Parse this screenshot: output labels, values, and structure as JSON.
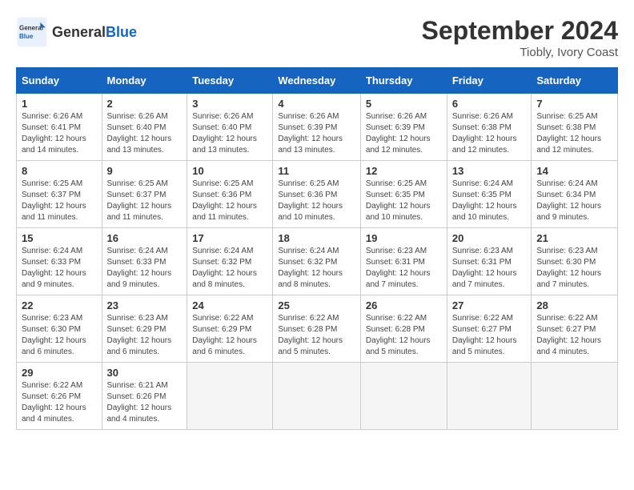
{
  "header": {
    "logo_general": "General",
    "logo_blue": "Blue",
    "month_title": "September 2024",
    "location": "Tiobly, Ivory Coast"
  },
  "days_of_week": [
    "Sunday",
    "Monday",
    "Tuesday",
    "Wednesday",
    "Thursday",
    "Friday",
    "Saturday"
  ],
  "weeks": [
    [
      {
        "day": "1",
        "info": "Sunrise: 6:26 AM\nSunset: 6:41 PM\nDaylight: 12 hours\nand 14 minutes."
      },
      {
        "day": "2",
        "info": "Sunrise: 6:26 AM\nSunset: 6:40 PM\nDaylight: 12 hours\nand 13 minutes."
      },
      {
        "day": "3",
        "info": "Sunrise: 6:26 AM\nSunset: 6:40 PM\nDaylight: 12 hours\nand 13 minutes."
      },
      {
        "day": "4",
        "info": "Sunrise: 6:26 AM\nSunset: 6:39 PM\nDaylight: 12 hours\nand 13 minutes."
      },
      {
        "day": "5",
        "info": "Sunrise: 6:26 AM\nSunset: 6:39 PM\nDaylight: 12 hours\nand 12 minutes."
      },
      {
        "day": "6",
        "info": "Sunrise: 6:26 AM\nSunset: 6:38 PM\nDaylight: 12 hours\nand 12 minutes."
      },
      {
        "day": "7",
        "info": "Sunrise: 6:25 AM\nSunset: 6:38 PM\nDaylight: 12 hours\nand 12 minutes."
      }
    ],
    [
      {
        "day": "8",
        "info": "Sunrise: 6:25 AM\nSunset: 6:37 PM\nDaylight: 12 hours\nand 11 minutes."
      },
      {
        "day": "9",
        "info": "Sunrise: 6:25 AM\nSunset: 6:37 PM\nDaylight: 12 hours\nand 11 minutes."
      },
      {
        "day": "10",
        "info": "Sunrise: 6:25 AM\nSunset: 6:36 PM\nDaylight: 12 hours\nand 11 minutes."
      },
      {
        "day": "11",
        "info": "Sunrise: 6:25 AM\nSunset: 6:36 PM\nDaylight: 12 hours\nand 10 minutes."
      },
      {
        "day": "12",
        "info": "Sunrise: 6:25 AM\nSunset: 6:35 PM\nDaylight: 12 hours\nand 10 minutes."
      },
      {
        "day": "13",
        "info": "Sunrise: 6:24 AM\nSunset: 6:35 PM\nDaylight: 12 hours\nand 10 minutes."
      },
      {
        "day": "14",
        "info": "Sunrise: 6:24 AM\nSunset: 6:34 PM\nDaylight: 12 hours\nand 9 minutes."
      }
    ],
    [
      {
        "day": "15",
        "info": "Sunrise: 6:24 AM\nSunset: 6:33 PM\nDaylight: 12 hours\nand 9 minutes."
      },
      {
        "day": "16",
        "info": "Sunrise: 6:24 AM\nSunset: 6:33 PM\nDaylight: 12 hours\nand 9 minutes."
      },
      {
        "day": "17",
        "info": "Sunrise: 6:24 AM\nSunset: 6:32 PM\nDaylight: 12 hours\nand 8 minutes."
      },
      {
        "day": "18",
        "info": "Sunrise: 6:24 AM\nSunset: 6:32 PM\nDaylight: 12 hours\nand 8 minutes."
      },
      {
        "day": "19",
        "info": "Sunrise: 6:23 AM\nSunset: 6:31 PM\nDaylight: 12 hours\nand 7 minutes."
      },
      {
        "day": "20",
        "info": "Sunrise: 6:23 AM\nSunset: 6:31 PM\nDaylight: 12 hours\nand 7 minutes."
      },
      {
        "day": "21",
        "info": "Sunrise: 6:23 AM\nSunset: 6:30 PM\nDaylight: 12 hours\nand 7 minutes."
      }
    ],
    [
      {
        "day": "22",
        "info": "Sunrise: 6:23 AM\nSunset: 6:30 PM\nDaylight: 12 hours\nand 6 minutes."
      },
      {
        "day": "23",
        "info": "Sunrise: 6:23 AM\nSunset: 6:29 PM\nDaylight: 12 hours\nand 6 minutes."
      },
      {
        "day": "24",
        "info": "Sunrise: 6:22 AM\nSunset: 6:29 PM\nDaylight: 12 hours\nand 6 minutes."
      },
      {
        "day": "25",
        "info": "Sunrise: 6:22 AM\nSunset: 6:28 PM\nDaylight: 12 hours\nand 5 minutes."
      },
      {
        "day": "26",
        "info": "Sunrise: 6:22 AM\nSunset: 6:28 PM\nDaylight: 12 hours\nand 5 minutes."
      },
      {
        "day": "27",
        "info": "Sunrise: 6:22 AM\nSunset: 6:27 PM\nDaylight: 12 hours\nand 5 minutes."
      },
      {
        "day": "28",
        "info": "Sunrise: 6:22 AM\nSunset: 6:27 PM\nDaylight: 12 hours\nand 4 minutes."
      }
    ],
    [
      {
        "day": "29",
        "info": "Sunrise: 6:22 AM\nSunset: 6:26 PM\nDaylight: 12 hours\nand 4 minutes."
      },
      {
        "day": "30",
        "info": "Sunrise: 6:21 AM\nSunset: 6:26 PM\nDaylight: 12 hours\nand 4 minutes."
      },
      {
        "day": "",
        "info": ""
      },
      {
        "day": "",
        "info": ""
      },
      {
        "day": "",
        "info": ""
      },
      {
        "day": "",
        "info": ""
      },
      {
        "day": "",
        "info": ""
      }
    ]
  ]
}
